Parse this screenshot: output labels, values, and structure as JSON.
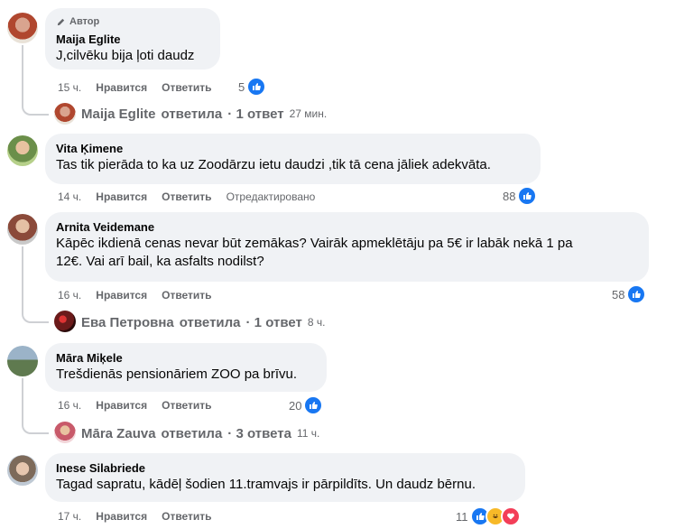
{
  "comments": [
    {
      "author": "Maija Eglite",
      "badge": "Автор",
      "text": "J,cilvēku bija ļoti daudz",
      "time": "15 ч.",
      "like": "Нравится",
      "reply": "Ответить",
      "reactions": "5",
      "thread": {
        "name": "Maija Eglite",
        "verb": "ответила",
        "count": "· 1 ответ",
        "time": "27 мин."
      }
    },
    {
      "author": "Vita Ķimene",
      "text": "Tas tik pierāda to ka uz Zoodārzu ietu daudzi ,tik tā cena jāliek adekvāta.",
      "time": "14 ч.",
      "like": "Нравится",
      "reply": "Ответить",
      "edited": "Отредактировано",
      "reactions": "88"
    },
    {
      "author": "Arnita Veidemane",
      "text_line1": "Kāpēc ikdienā cenas nevar būt zemākas? Vairāk apmeklētāju pa 5€ ir labāk nekā 1 pa",
      "text_line2": "12€. Vai arī bail, ka asfalts nodilst?",
      "time": "16 ч.",
      "like": "Нравится",
      "reply": "Ответить",
      "reactions": "58",
      "thread": {
        "name": "Ева Петровна",
        "verb": "ответила",
        "count": "· 1 ответ",
        "time": "8 ч."
      }
    },
    {
      "author": "Māra Miķele",
      "text": "Trešdienās pensionāriem ZOO pa brīvu.",
      "time": "16 ч.",
      "like": "Нравится",
      "reply": "Ответить",
      "reactions": "20",
      "thread": {
        "name": "Māra Zauva",
        "verb": "ответила",
        "count": "· 3 ответа",
        "time": "11 ч."
      }
    },
    {
      "author": "Inese Silabriede",
      "text": "Tagad sapratu, kādēļ šodien 11.tramvajs ir pārpildīts. Un daudz bērnu.",
      "time": "17 ч.",
      "like": "Нравится",
      "reply": "Ответить",
      "reactions": "11"
    }
  ],
  "colors": {
    "like_blue": "#1877f2",
    "bubble": "#f0f2f5",
    "muted": "#65676b",
    "thread_line": "#ced0d4"
  }
}
